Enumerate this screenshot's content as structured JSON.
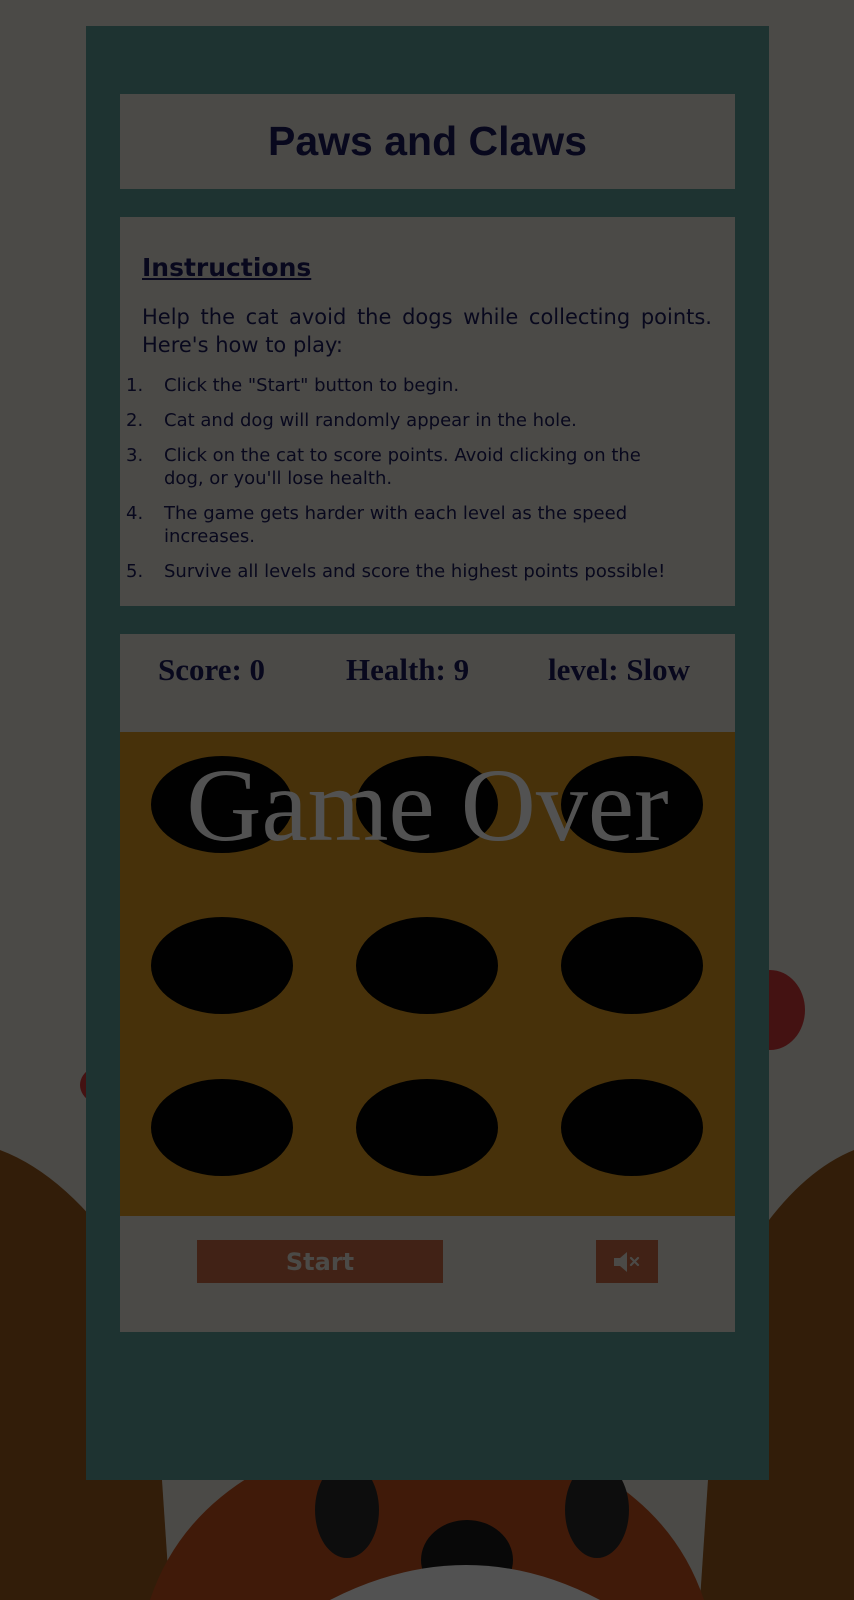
{
  "header": {
    "title": "Paws and Claws"
  },
  "instructions": {
    "heading": "Instructions",
    "intro_line1": "Help the cat avoid the dogs while collecting points.",
    "intro_line2": "Here's how to play:",
    "steps": [
      {
        "num": "1.",
        "text": "Click the \"Start\" button to begin."
      },
      {
        "num": "2.",
        "text": "Cat and dog will randomly appear in the hole."
      },
      {
        "num": "3.",
        "text": "Click on the cat to score points. Avoid clicking on the dog, or you'll lose health."
      },
      {
        "num": "4.",
        "text": "The game gets harder with each level as the speed increases."
      },
      {
        "num": "5.",
        "text": "Survive all levels and score the highest points possible!"
      }
    ]
  },
  "stats": {
    "score": "Score: 0",
    "health": "Health: 9",
    "level": "level: Slow"
  },
  "board": {
    "game_over": "Game Over",
    "holes": 9
  },
  "controls": {
    "start_label": "Start",
    "mute_icon": "speaker-muted-icon"
  },
  "colors": {
    "panel": "#5f9f9a",
    "box": "#e9e6dc",
    "board": "#dc991f",
    "button": "#cb6a44",
    "text": "#191a5c"
  }
}
